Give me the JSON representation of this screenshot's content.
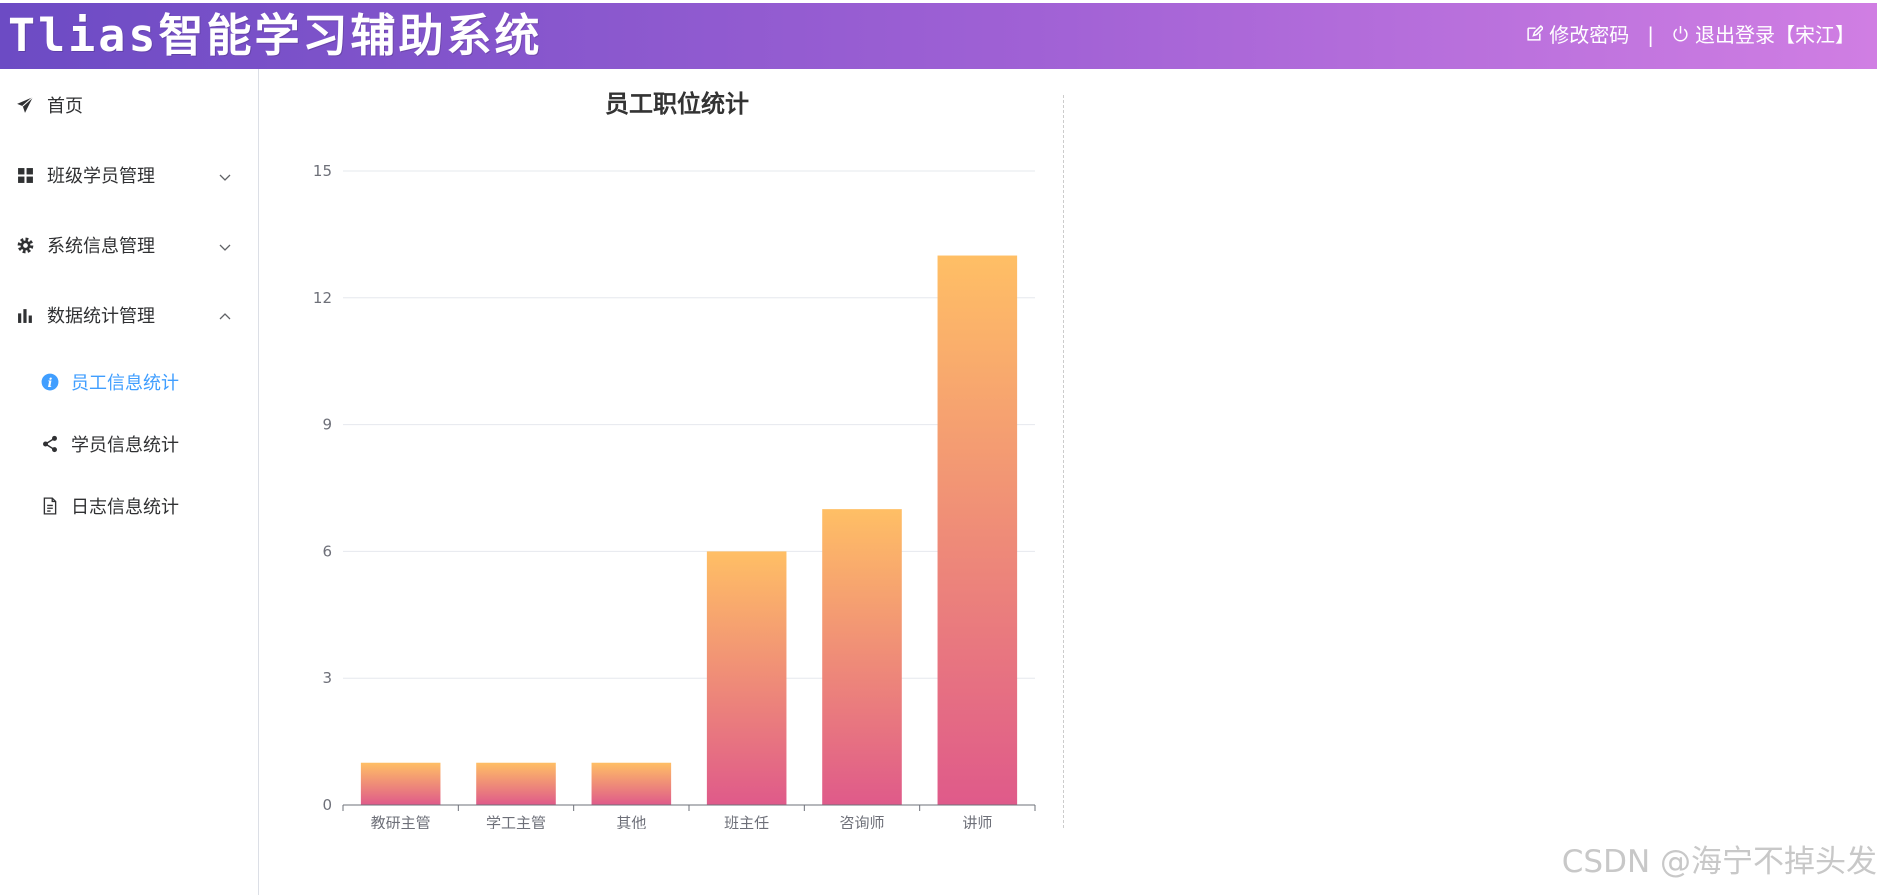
{
  "header": {
    "title": "Tlias智能学习辅助系统",
    "change_password": "修改密码",
    "separator": "|",
    "logout": "退出登录【宋江】"
  },
  "sidebar": {
    "items": [
      {
        "label": "首页",
        "icon": "send-icon"
      },
      {
        "label": "班级学员管理",
        "icon": "grid-icon"
      },
      {
        "label": "系统信息管理",
        "icon": "gear-icon"
      },
      {
        "label": "数据统计管理",
        "icon": "bar-chart-icon"
      }
    ],
    "sub_items": [
      {
        "label": "员工信息统计",
        "icon": "info-icon",
        "active": true
      },
      {
        "label": "学员信息统计",
        "icon": "share-icon",
        "active": false
      },
      {
        "label": "日志信息统计",
        "icon": "document-icon",
        "active": false
      }
    ],
    "active_color": "#409eff"
  },
  "chart_data": {
    "type": "bar",
    "title": "员工职位统计",
    "categories": [
      "教研主管",
      "学工主管",
      "其他",
      "班主任",
      "咨询师",
      "讲师"
    ],
    "values": [
      1,
      1,
      1,
      6,
      7,
      13
    ],
    "ylim": [
      0,
      15
    ],
    "yticks": [
      0,
      3,
      6,
      9,
      12,
      15
    ],
    "grid": true,
    "gradient": {
      "top": "#ffbf65",
      "bottom": "#df5a8a"
    }
  },
  "watermark": "CSDN @海宁不掉头发"
}
